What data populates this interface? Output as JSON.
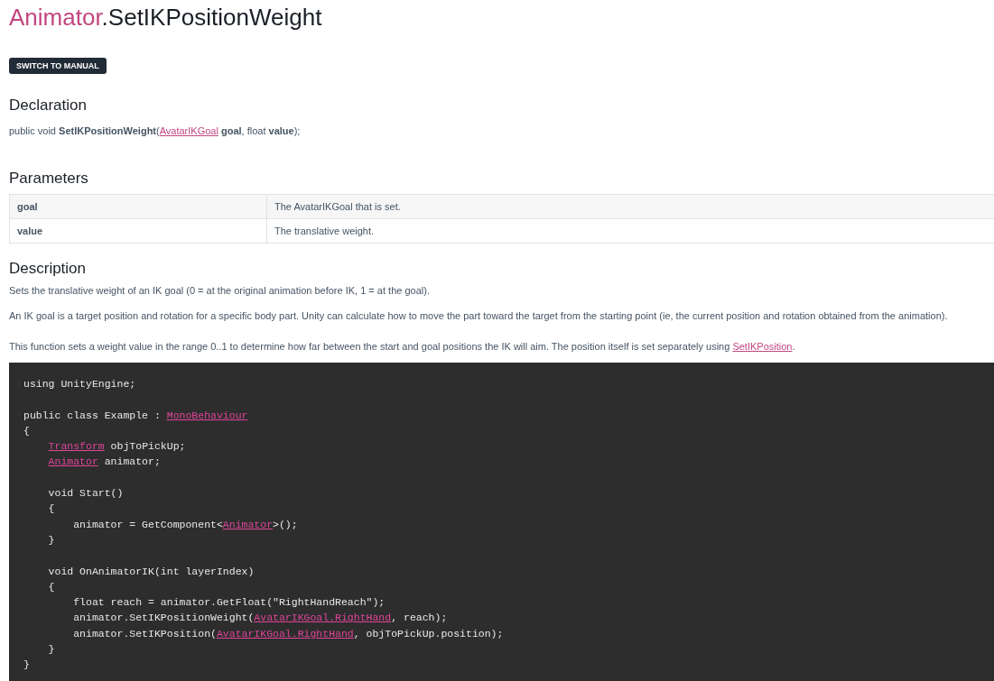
{
  "title": {
    "class_name": "Animator",
    "member_name": ".SetIKPositionWeight"
  },
  "switch_button": "SWITCH TO MANUAL",
  "declaration": {
    "heading": "Declaration",
    "segments": [
      {
        "kind": "plain",
        "text": "public void "
      },
      {
        "kind": "bold",
        "text": "SetIKPositionWeight"
      },
      {
        "kind": "plain",
        "text": "("
      },
      {
        "kind": "link",
        "text": "AvatarIKGoal"
      },
      {
        "kind": "bold",
        "text": " goal"
      },
      {
        "kind": "plain",
        "text": ", float "
      },
      {
        "kind": "bold",
        "text": "value"
      },
      {
        "kind": "plain",
        "text": ");"
      }
    ]
  },
  "parameters": {
    "heading": "Parameters",
    "rows": [
      {
        "name": "goal",
        "description": "The AvatarIKGoal that is set."
      },
      {
        "name": "value",
        "description": "The translative weight."
      }
    ]
  },
  "description": {
    "heading": "Description",
    "paragraphs": [
      [
        {
          "kind": "plain",
          "text": "Sets the translative weight of an IK goal (0 = at the original animation before IK, 1 = at the goal)."
        }
      ],
      [
        {
          "kind": "plain",
          "text": "An IK goal is a target position and rotation for a specific body part. Unity can calculate how to move the part toward the target from the starting point (ie, the current position and rotation obtained from the animation)."
        }
      ],
      [
        {
          "kind": "plain",
          "text": "This function sets a weight value in the range 0..1 to determine how far between the start and goal positions the IK will aim. The position itself is set separately using "
        },
        {
          "kind": "link",
          "text": "SetIKPosition"
        },
        {
          "kind": "plain",
          "text": "."
        }
      ]
    ]
  },
  "code_lines": [
    {
      "kind": "code",
      "segments": [
        {
          "kind": "plain",
          "text": "using UnityEngine;"
        }
      ]
    },
    {
      "kind": "blank"
    },
    {
      "kind": "code",
      "segments": [
        {
          "kind": "plain",
          "text": "public class Example : "
        },
        {
          "kind": "link",
          "text": "MonoBehaviour"
        }
      ]
    },
    {
      "kind": "code",
      "segments": [
        {
          "kind": "plain",
          "text": "{"
        }
      ]
    },
    {
      "kind": "indented",
      "segments": [
        {
          "kind": "link",
          "text": "Transform"
        },
        {
          "kind": "plain",
          "text": " objToPickUp;"
        }
      ]
    },
    {
      "kind": "indented",
      "segments": [
        {
          "kind": "link",
          "text": "Animator"
        },
        {
          "kind": "plain",
          "text": " animator;"
        }
      ]
    },
    {
      "kind": "blank"
    },
    {
      "kind": "code",
      "segments": [
        {
          "kind": "plain",
          "text": "    void Start()"
        }
      ]
    },
    {
      "kind": "code",
      "segments": [
        {
          "kind": "plain",
          "text": "    {"
        }
      ]
    },
    {
      "kind": "code",
      "segments": [
        {
          "kind": "plain",
          "text": "        animator = GetComponent<"
        },
        {
          "kind": "link",
          "text": "Animator"
        },
        {
          "kind": "plain",
          "text": ">();"
        }
      ]
    },
    {
      "kind": "code",
      "segments": [
        {
          "kind": "plain",
          "text": "    }"
        }
      ]
    },
    {
      "kind": "blank"
    },
    {
      "kind": "code",
      "segments": [
        {
          "kind": "plain",
          "text": "    void OnAnimatorIK(int layerIndex)"
        }
      ]
    },
    {
      "kind": "code",
      "segments": [
        {
          "kind": "plain",
          "text": "    {"
        }
      ]
    },
    {
      "kind": "code",
      "segments": [
        {
          "kind": "plain",
          "text": "        float reach = animator.GetFloat(\"RightHandReach\");"
        }
      ]
    },
    {
      "kind": "code",
      "segments": [
        {
          "kind": "plain",
          "text": "        animator.SetIKPositionWeight("
        },
        {
          "kind": "link",
          "text": "AvatarIKGoal.RightHand"
        },
        {
          "kind": "plain",
          "text": ", reach);"
        }
      ]
    },
    {
      "kind": "code",
      "segments": [
        {
          "kind": "plain",
          "text": "        animator.SetIKPosition("
        },
        {
          "kind": "link",
          "text": "AvatarIKGoal.RightHand"
        },
        {
          "kind": "plain",
          "text": ", objToPickUp.position);"
        }
      ]
    },
    {
      "kind": "code",
      "segments": [
        {
          "kind": "plain",
          "text": "    }"
        }
      ]
    },
    {
      "kind": "code",
      "segments": [
        {
          "kind": "plain",
          "text": "}"
        }
      ]
    }
  ]
}
